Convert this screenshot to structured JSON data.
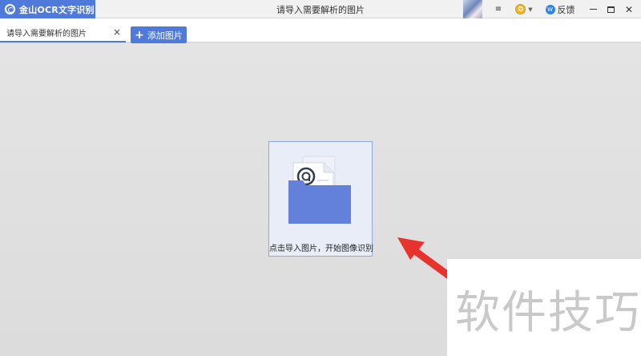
{
  "app": {
    "name": "金山OCR文字识别",
    "window_title": "请导入需要解析的图片"
  },
  "titlebar": {
    "menu_glyph": "≡",
    "coin_glyph": "✪",
    "feedback_badge": "W",
    "feedback_label": "反馈",
    "minimize_glyph": "",
    "maximize_glyph": "",
    "close_glyph": "✕"
  },
  "tabs": [
    {
      "label": "请导入需要解析的图片",
      "close": "×"
    }
  ],
  "toolbar": {
    "add_plus": "+",
    "add_label": "添加图片"
  },
  "dropzone": {
    "hint": "点击导入图片，开始图像识别"
  },
  "watermark": "软件技巧",
  "colors": {
    "accent": "#4f7ad9",
    "folder": "#6380db",
    "arrow": "#e8322c",
    "background": "#e1e1e1"
  },
  "icons": [
    "app-logo-icon",
    "menu-icon",
    "coin-icon",
    "feedback-icon",
    "minimize-icon",
    "maximize-icon",
    "close-icon",
    "folder-icon",
    "arrow-icon"
  ]
}
